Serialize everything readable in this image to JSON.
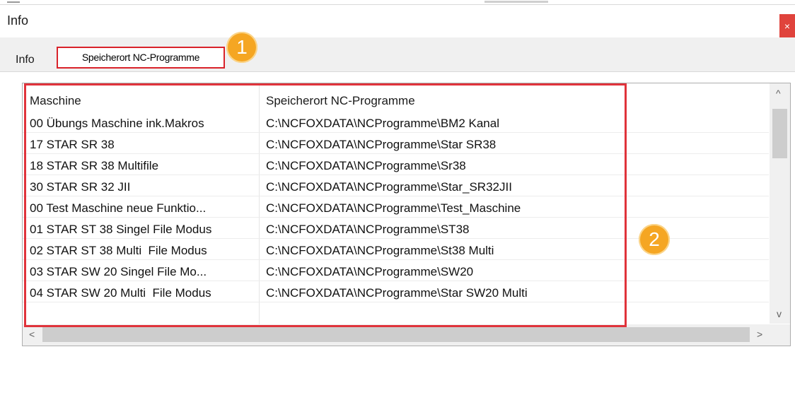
{
  "window": {
    "title": "Info",
    "close_glyph": "×"
  },
  "tabs": [
    {
      "label": "Info"
    },
    {
      "label": "Speicherort NC-Programme"
    }
  ],
  "table": {
    "columns": [
      "Maschine",
      "Speicherort NC-Programme"
    ],
    "rows": [
      [
        "00 Übungs Maschine ink.Makros",
        "C:\\NCFOXDATA\\NCProgramme\\BM2 Kanal"
      ],
      [
        "17 STAR SR 38",
        "C:\\NCFOXDATA\\NCProgramme\\Star SR38"
      ],
      [
        "18 STAR SR 38 Multifile",
        "C:\\NCFOXDATA\\NCProgramme\\Sr38"
      ],
      [
        "30 STAR SR 32 JII",
        "C:\\NCFOXDATA\\NCProgramme\\Star_SR32JII"
      ],
      [
        "00 Test Maschine neue Funktio...",
        "C:\\NCFOXDATA\\NCProgramme\\Test_Maschine"
      ],
      [
        "01 STAR ST 38 Singel File Modus",
        "C:\\NCFOXDATA\\NCProgramme\\ST38"
      ],
      [
        "02 STAR ST 38 Multi  File Modus",
        "C:\\NCFOXDATA\\NCProgramme\\St38 Multi"
      ],
      [
        "03 STAR SW 20 Singel File Mo...",
        "C:\\NCFOXDATA\\NCProgramme\\SW20"
      ],
      [
        "04 STAR SW 20 Multi  File Modus",
        "C:\\NCFOXDATA\\NCProgramme\\Star SW20 Multi"
      ]
    ]
  },
  "scrollbar": {
    "up": "^",
    "down": "v",
    "left": "<",
    "right": ">"
  },
  "annotations": {
    "badge_1": "1",
    "badge_2": "2",
    "color": "#f5a623",
    "box_color": "#e0333b"
  }
}
